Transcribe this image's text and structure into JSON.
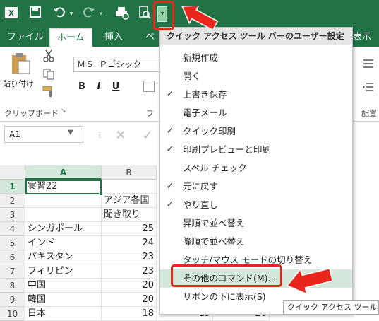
{
  "qat": {
    "dropdown_glyph": "▾",
    "icons": [
      "excel-logo-icon",
      "save-icon",
      "undo-icon",
      "undo-dropdown-icon",
      "redo-icon",
      "redo-dropdown-icon",
      "quick-print-icon",
      "print-preview-icon"
    ]
  },
  "tabs": [
    "ファイル",
    "ホーム",
    "挿入",
    "ペ",
    "表示"
  ],
  "ribbon": {
    "clipboard_label": "クリップボード",
    "paste_label": "貼り付け",
    "font_name": "ＭＳ Ｐゴシック",
    "bold": "B",
    "italic": "I",
    "underline": "U",
    "font_group_partial": "フ",
    "alignment_partial": "配置"
  },
  "formula_bar": {
    "name_box": "A1",
    "cancel": "✕",
    "enter": "✓"
  },
  "grid": {
    "columns": [
      "A",
      "B"
    ],
    "rows": [
      {
        "n": "1",
        "a": "実習22",
        "b": ""
      },
      {
        "n": "2",
        "a": "",
        "b": "アジア各国"
      },
      {
        "n": "3",
        "a": "",
        "b": "聞き取り"
      },
      {
        "n": "4",
        "a": "シンガポール",
        "b": "25"
      },
      {
        "n": "5",
        "a": "インド",
        "b": "24"
      },
      {
        "n": "6",
        "a": "パキスタン",
        "b": "23"
      },
      {
        "n": "7",
        "a": "フィリピン",
        "b": "23"
      },
      {
        "n": "8",
        "a": "中国",
        "b": "20"
      },
      {
        "n": "9",
        "a": "韓国",
        "b": "20"
      },
      {
        "n": "10",
        "a": "日本",
        "b": "18"
      }
    ],
    "row10_extra": [
      "19",
      "20"
    ]
  },
  "menu": {
    "header": "クイック アクセス ツール バーのユーザー設定",
    "items": [
      {
        "label": "新規作成",
        "checked": false
      },
      {
        "label": "開く",
        "checked": false
      },
      {
        "label": "上書き保存",
        "checked": true
      },
      {
        "label": "電子メール",
        "checked": false
      },
      {
        "label": "クイック印刷",
        "checked": true
      },
      {
        "label": "印刷プレビューと印刷",
        "checked": true
      },
      {
        "label": "スペル チェック",
        "checked": false
      },
      {
        "label": "元に戻す",
        "checked": true
      },
      {
        "label": "やり直し",
        "checked": true
      },
      {
        "label": "昇順で並べ替え",
        "checked": false
      },
      {
        "label": "降順で並べ替え",
        "checked": false
      },
      {
        "label": "タッチ/マウス モードの切り替え",
        "checked": false
      },
      {
        "label": "その他のコマンド(M)...",
        "checked": false
      },
      {
        "label": "リボンの下に表示(S)",
        "checked": false
      }
    ],
    "check_glyph": "✓"
  },
  "tooltip": "クイック アクセス ツール バ",
  "colors": {
    "excel_green": "#217346",
    "annotation_red": "#e8261c",
    "hover": "#d3e8da"
  }
}
